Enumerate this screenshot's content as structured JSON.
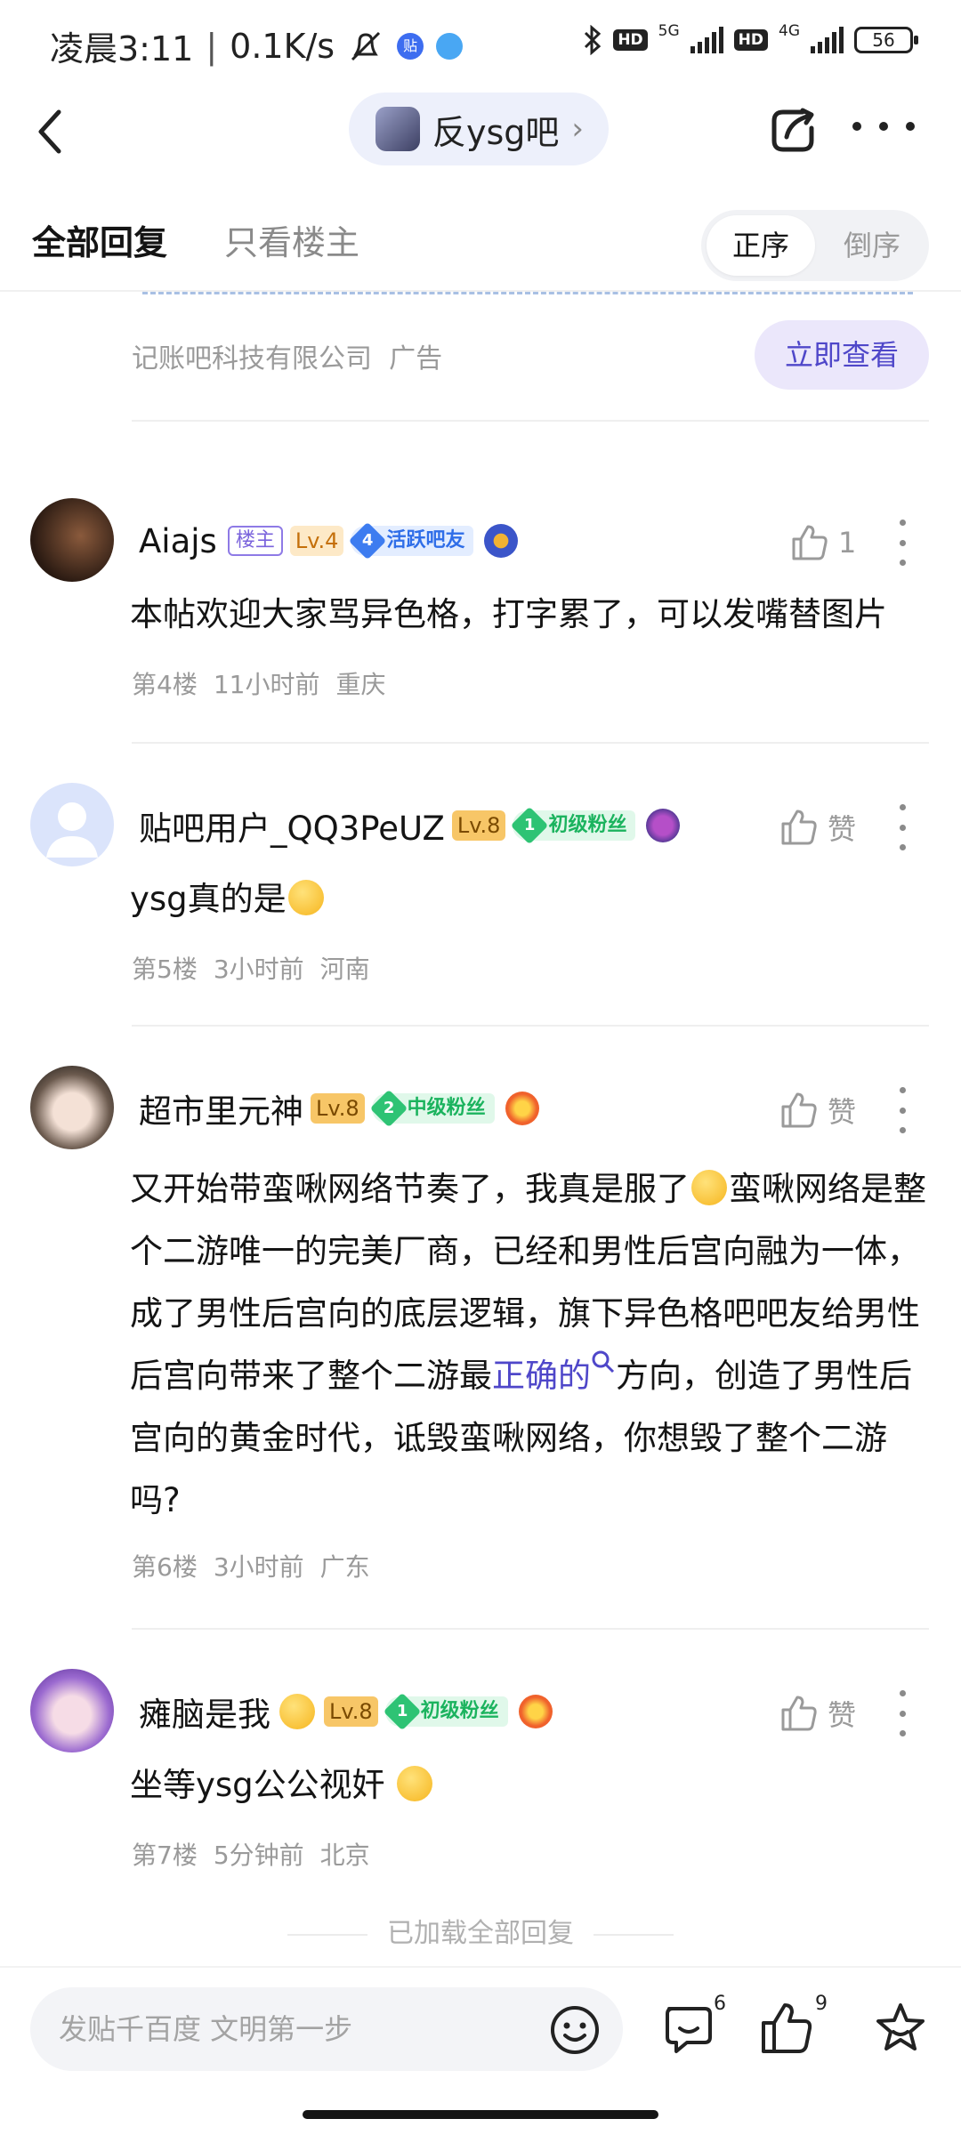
{
  "status_bar": {
    "time": "凌晨3:11",
    "speed": "0.1K/s",
    "network_1": "5G",
    "network_2": "4G",
    "hd_label": "HD",
    "battery": "56"
  },
  "header": {
    "forum_name": "反ysg吧",
    "chevron": "›"
  },
  "tabs": {
    "all_replies": "全部回复",
    "op_only": "只看楼主",
    "sort_asc": "正序",
    "sort_desc": "倒序"
  },
  "ad": {
    "source": "记账吧科技有限公司",
    "tag": "广告",
    "button": "立即查看"
  },
  "comments": [
    {
      "username": "Aiajs",
      "op_badge": "楼主",
      "level": "Lv.4",
      "fan_level": "4",
      "fan_title": "活跃吧友",
      "likes": "1",
      "text": "本帖欢迎大家骂异色格，打字累了，可以发嘴替图片",
      "floor": "第4楼",
      "time": "11小时前",
      "location": "重庆"
    },
    {
      "username": "贴吧用户_QQ3PeUZ",
      "level": "Lv.8",
      "fan_level": "1",
      "fan_title": "初级粉丝",
      "likes": "赞",
      "text": "ysg真的是",
      "floor": "第5楼",
      "time": "3小时前",
      "location": "河南"
    },
    {
      "username": "超市里元神",
      "level": "Lv.8",
      "fan_level": "2",
      "fan_title": "中级粉丝",
      "likes": "赞",
      "text_part1": "又开始带蛮啾网络节奏了，我真是服了",
      "text_part2": "蛮啾网络是整个二游唯一的完美厂商，已经和男性后宫向融为一体，成了男性后宫向的底层逻辑，旗下异色格吧吧友给男性后宫向带来了整个二游最",
      "text_link": "正确的",
      "text_part3": "方向，创造了男性后宫向的黄金时代，诋毁蛮啾网络，你想毁了整个二游吗?",
      "floor": "第6楼",
      "time": "3小时前",
      "location": "广东"
    },
    {
      "username": "瘫脑是我",
      "level": "Lv.8",
      "fan_level": "1",
      "fan_title": "初级粉丝",
      "likes": "赞",
      "text": "坐等ysg公公视奸",
      "floor": "第7楼",
      "time": "5分钟前",
      "location": "北京"
    }
  ],
  "loaded_all": "已加载全部回复",
  "bottom_bar": {
    "placeholder": "发贴千百度 文明第一步",
    "comment_count": "6",
    "like_count": "9"
  }
}
